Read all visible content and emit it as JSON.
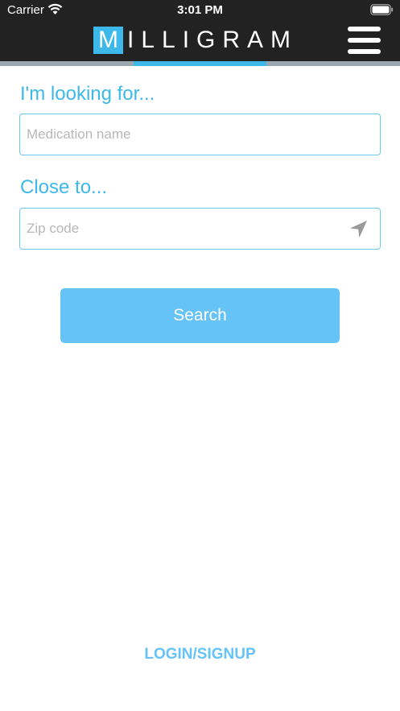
{
  "status_bar": {
    "carrier": "Carrier",
    "time": "3:01 PM",
    "wifi_icon": "wifi-icon",
    "battery_icon": "battery-icon"
  },
  "header": {
    "logo_first_letter": "M",
    "logo_rest": "ILLIGRAM",
    "menu_icon": "hamburger-menu-icon"
  },
  "form": {
    "medication_label": "I'm looking for...",
    "medication_placeholder": "Medication name",
    "medication_value": "",
    "location_label": "Close to...",
    "zip_placeholder": "Zip code",
    "zip_value": "",
    "location_icon": "location-arrow-icon",
    "search_button_label": "Search"
  },
  "footer": {
    "login_label": "LOGIN/SIGNUP"
  },
  "colors": {
    "header_bg": "#222222",
    "accent": "#3cb9ea",
    "button_bg": "#66c3f7",
    "tab_inactive": "#9aa6b0"
  }
}
